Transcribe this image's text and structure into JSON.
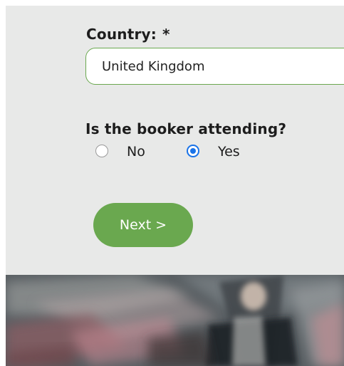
{
  "form": {
    "country_label": "Country:",
    "required_mark": "*",
    "country_value": "United Kingdom",
    "booker_question": "Is the booker attending?",
    "options": [
      {
        "label": "No",
        "checked": false
      },
      {
        "label": "Yes",
        "checked": true
      }
    ],
    "next_label": "Next >"
  },
  "colors": {
    "accent": "#6aa84f",
    "radio_selected": "#1a73e8",
    "panel_background": "#e8e9e8"
  },
  "hero": {
    "icon": "blurred-crowd-photo"
  }
}
